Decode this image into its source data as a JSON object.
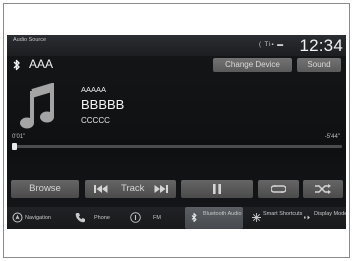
{
  "statusbar": {
    "source_label": "Audio Source",
    "status_icons": "( Ti▪ ▬",
    "clock": "12:34"
  },
  "device": {
    "name": "AAA",
    "change_device_label": "Change Device",
    "sound_label": "Sound"
  },
  "now_playing": {
    "artist": "AAAAA",
    "title": "BBBBB",
    "album": "CCCCC",
    "elapsed": "0'01\"",
    "remaining": "-5'44\"",
    "progress_fraction": 0.01
  },
  "controls": {
    "browse_label": "Browse",
    "track_label": "Track"
  },
  "bottom_nav": {
    "items": [
      {
        "label": "Navigation",
        "icon": "navigation-icon"
      },
      {
        "label": "Phone",
        "icon": "phone-icon"
      },
      {
        "label": "FM",
        "icon": "radio-icon"
      },
      {
        "label": "Bluetooth Audio",
        "icon": "bluetooth-icon"
      },
      {
        "label": "Smart Shortcuts",
        "icon": "shortcuts-icon"
      },
      {
        "label": "Display Mode",
        "icon": "display-mode-icon"
      }
    ]
  },
  "colors": {
    "screen_bg": "#141618",
    "button_bg": "#5a5a5a",
    "text": "#e8e8e8"
  }
}
